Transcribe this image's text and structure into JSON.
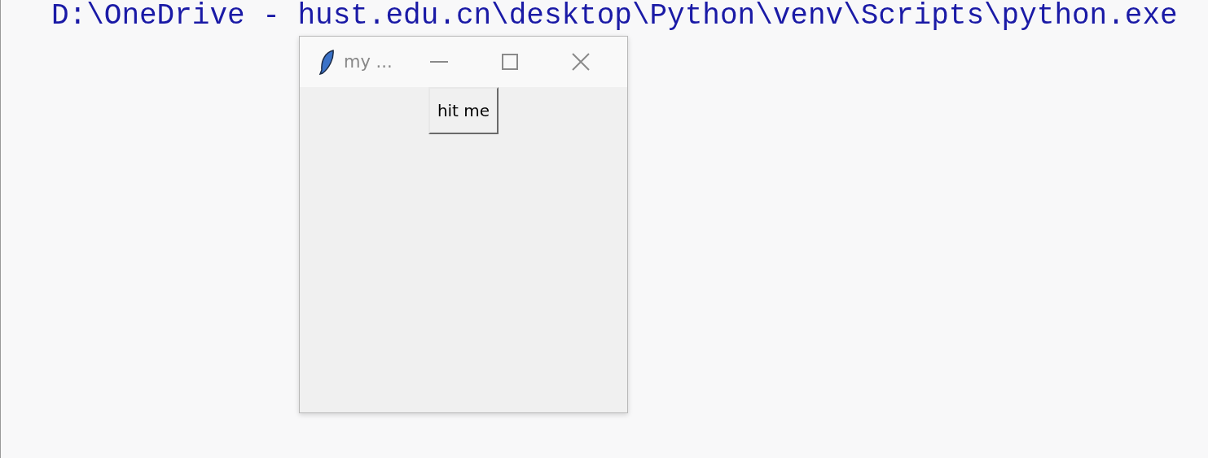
{
  "console": {
    "line": "D:\\OneDrive - hust.edu.cn\\desktop\\Python\\venv\\Scripts\\python.exe"
  },
  "window": {
    "title": "my ...",
    "button": "hit me"
  }
}
